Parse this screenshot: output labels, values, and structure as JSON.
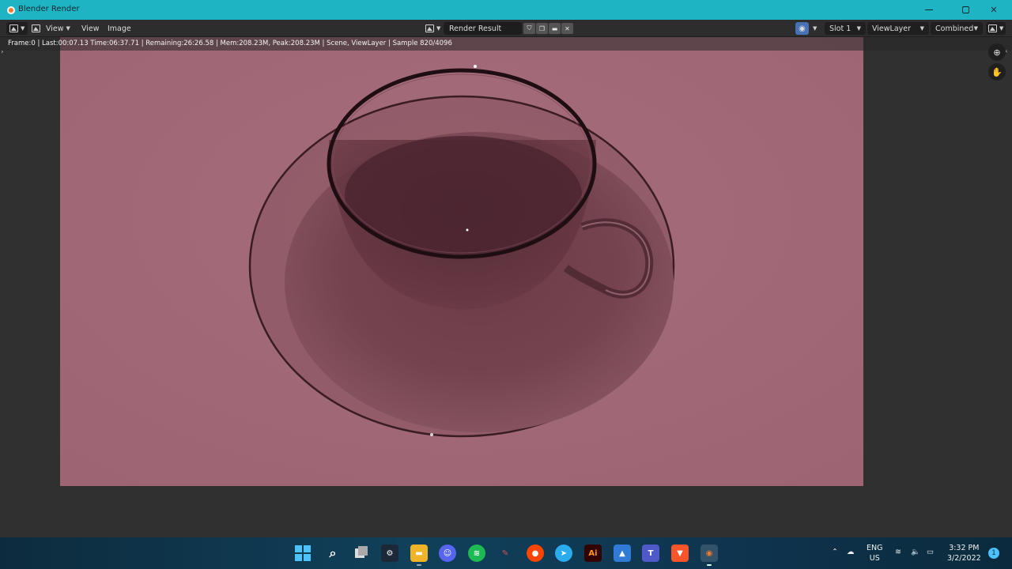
{
  "window": {
    "title": "Blender Render"
  },
  "header": {
    "view_menu": "View",
    "view2_menu": "View",
    "image_menu": "Image",
    "image_name": "Render Result",
    "slot": "Slot 1",
    "view_layer": "ViewLayer",
    "pass": "Combined"
  },
  "status": {
    "info": "Frame:0 | Last:00:07.13 Time:06:37.71 | Remaining:26:26.58 | Mem:208.23M, Peak:208.23M | Scene, ViewLayer | Sample 820/4096"
  },
  "render": {
    "background_color": "#a06876",
    "accent": "#4772b3"
  },
  "taskbar": {
    "icons": [
      "windows-start",
      "search",
      "task-view",
      "steam",
      "file-explorer",
      "discord",
      "spotify",
      "pencil-app",
      "reddit",
      "telegram",
      "adobe-illustrator",
      "photos",
      "teams",
      "brave",
      "blender"
    ],
    "illustrator_label": "Ai",
    "lang_top": "ENG",
    "lang_bottom": "US",
    "time": "3:32 PM",
    "date": "3/2/2022",
    "notification_count": "1"
  }
}
